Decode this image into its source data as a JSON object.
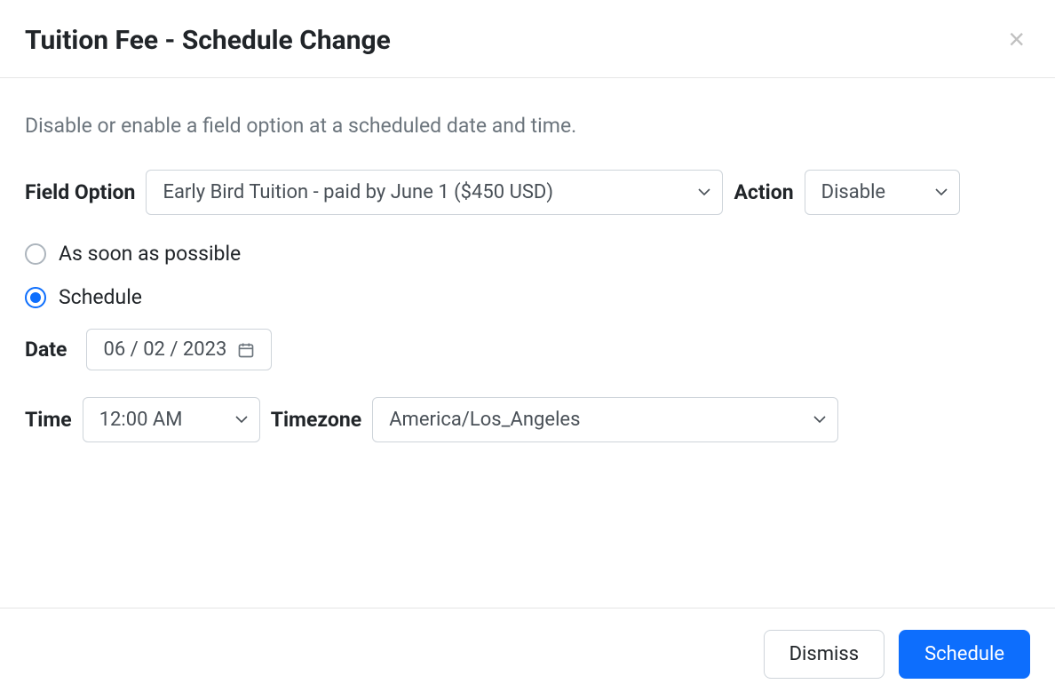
{
  "header": {
    "title": "Tuition Fee - Schedule Change"
  },
  "body": {
    "description": "Disable or enable a field option at a scheduled date and time.",
    "field_option_label": "Field Option",
    "field_option_value": "Early Bird Tuition - paid by June 1 ($450 USD)",
    "action_label": "Action",
    "action_value": "Disable",
    "radio": {
      "asap": "As soon as possible",
      "schedule": "Schedule",
      "selected": "schedule"
    },
    "date_label": "Date",
    "date_value": "06 / 02 / 2023",
    "time_label": "Time",
    "time_value": "12:00 AM",
    "timezone_label": "Timezone",
    "timezone_value": "America/Los_Angeles"
  },
  "footer": {
    "dismiss": "Dismiss",
    "schedule": "Schedule"
  }
}
